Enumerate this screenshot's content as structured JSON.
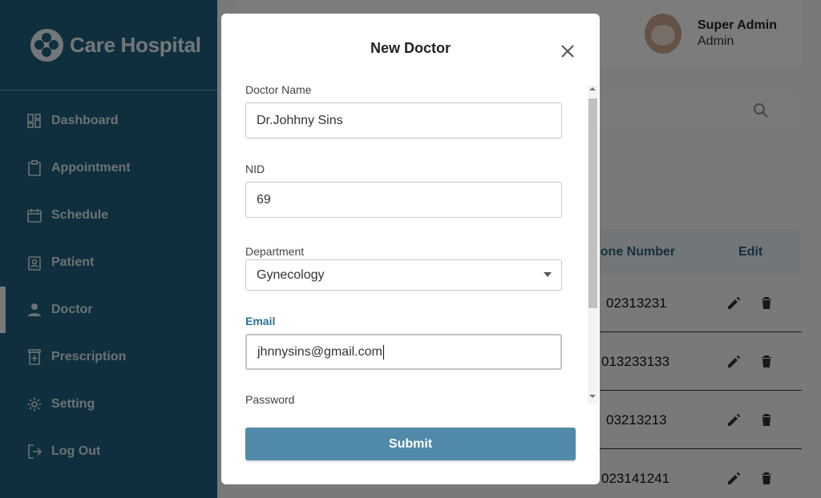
{
  "brand": {
    "name": "Care Hospital",
    "logo_icon": "hospital-logo-icon"
  },
  "sidebar": {
    "items": [
      {
        "label": "Dashboard",
        "icon": "dashboard-icon"
      },
      {
        "label": "Appointment",
        "icon": "clipboard-icon"
      },
      {
        "label": "Schedule",
        "icon": "calendar-icon"
      },
      {
        "label": "Patient",
        "icon": "patient-badge-icon"
      },
      {
        "label": "Doctor",
        "icon": "person-icon",
        "active": true
      },
      {
        "label": "Prescription",
        "icon": "prescription-icon"
      },
      {
        "label": "Setting",
        "icon": "gear-icon"
      },
      {
        "label": "Log Out",
        "icon": "logout-icon"
      }
    ]
  },
  "profile": {
    "name": "Super Admin",
    "role": "Admin"
  },
  "table": {
    "headers": {
      "phone": "Phone Number",
      "phone_visible": "hone Number",
      "edit": "Edit"
    },
    "rows": [
      {
        "phone": "02313231"
      },
      {
        "phone": "013233133"
      },
      {
        "phone": "03213213"
      },
      {
        "phone": "023141241"
      }
    ]
  },
  "modal": {
    "title": "New Doctor",
    "fields": {
      "doctor_name": {
        "label": "Doctor Name",
        "value": "Dr.Johhny Sins"
      },
      "nid": {
        "label": "NID",
        "value": "69"
      },
      "department": {
        "label": "Department",
        "value": "Gynecology"
      },
      "email": {
        "label": "Email",
        "value": "jhnnysins@gmail.com"
      },
      "password": {
        "label": "Password"
      }
    },
    "submit_label": "Submit"
  },
  "colors": {
    "sidebar_bg": "#1e5e7c",
    "accent": "#508aa8",
    "focused_label": "#2b6f96"
  }
}
